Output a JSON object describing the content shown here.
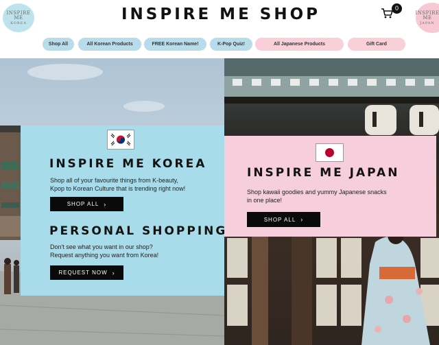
{
  "header": {
    "title": "INSPIRE ME SHOP",
    "logo_left": {
      "line1": "INSPIRE ME",
      "line2": "KOREA"
    },
    "logo_right": {
      "line1": "INSPIRE ME",
      "line2": "JAPAN"
    },
    "cart": {
      "icon": "shopping-cart-icon",
      "count": "0"
    }
  },
  "nav": {
    "items": [
      {
        "label": "Shop All",
        "color": "#b9dcea"
      },
      {
        "label": "All Korean Products",
        "color": "#b9dcea"
      },
      {
        "label": "FREE Korean Name!",
        "color": "#b9dcea"
      },
      {
        "label": "K-Pop Quiz!",
        "color": "#b9dcea"
      },
      {
        "label": "All Japanese Products",
        "color": "#f9cfd9"
      },
      {
        "label": "Gift Card",
        "color": "#f9cfd9"
      }
    ]
  },
  "korea": {
    "flag": "south-korea-flag",
    "heading": "INSPIRE ME KOREA",
    "text_line1": "Shop all of your favourite things from K-beauty,",
    "text_line2": "Kpop to Korean Culture that is trending right now!",
    "shop_button": "SHOP ALL",
    "personal_heading": "PERSONAL SHOPPING",
    "personal_line1": "Don't see what you want in our shop?",
    "personal_line2": "Request anything you want from Korea!",
    "request_button": "REQUEST NOW",
    "panel_color": "#a8dcea"
  },
  "japan": {
    "flag": "japan-flag",
    "heading": "INSPIRE ME JAPAN",
    "text_line1": "Shop kawaii goodies and yummy Japanese snacks",
    "text_line2": "in one place!",
    "shop_button": "SHOP ALL",
    "panel_color": "#f7cedb"
  },
  "icons": {
    "chevron": "chevron-right-icon"
  }
}
